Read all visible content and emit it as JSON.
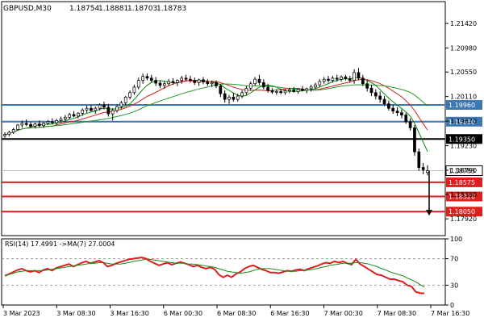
{
  "chart_data": {
    "type": "candlestick",
    "symbol_header": "GBPUSD,M30",
    "ohlc_readout": [
      "1.18754",
      "1.18881",
      "1.18703",
      "1.18783"
    ],
    "price_axis": {
      "ylim": [
        1.1762,
        1.2181
      ],
      "ticks": [
        "1.21420",
        "1.20980",
        "1.20550",
        "1.20110",
        "1.19670",
        "1.19230",
        "1.18790",
        "1.18360",
        "1.17920"
      ]
    },
    "horizontal_levels": [
      {
        "label": "1.19960",
        "value": 1.1996,
        "color": "#3b77b3"
      },
      {
        "label": "1.19660",
        "value": 1.1966,
        "color": "#3b77b3"
      },
      {
        "label": "1.19350",
        "value": 1.1935,
        "color": "#000000"
      },
      {
        "label": "1.18575",
        "value": 1.18575,
        "color": "#e01e1e"
      },
      {
        "label": "1.18320",
        "value": 1.1832,
        "color": "#e01e1e"
      },
      {
        "label": "1.18050",
        "value": 1.1805,
        "color": "#e01e1e"
      }
    ],
    "current_price": {
      "label": "1.18783",
      "value": 1.18783
    },
    "arrow_target": 1.1798,
    "candles": [
      {
        "o": 1.1941,
        "h": 1.1947,
        "l": 1.1937,
        "c": 1.1943
      },
      {
        "o": 1.1943,
        "h": 1.195,
        "l": 1.194,
        "c": 1.1947
      },
      {
        "o": 1.1947,
        "h": 1.1955,
        "l": 1.1944,
        "c": 1.1952
      },
      {
        "o": 1.1952,
        "h": 1.1962,
        "l": 1.195,
        "c": 1.196
      },
      {
        "o": 1.196,
        "h": 1.1968,
        "l": 1.1955,
        "c": 1.1963
      },
      {
        "o": 1.1963,
        "h": 1.197,
        "l": 1.1958,
        "c": 1.1961
      },
      {
        "o": 1.1961,
        "h": 1.1965,
        "l": 1.1955,
        "c": 1.1958
      },
      {
        "o": 1.1958,
        "h": 1.1964,
        "l": 1.1954,
        "c": 1.1962
      },
      {
        "o": 1.1962,
        "h": 1.1968,
        "l": 1.1956,
        "c": 1.1959
      },
      {
        "o": 1.1959,
        "h": 1.1965,
        "l": 1.1955,
        "c": 1.1963
      },
      {
        "o": 1.1963,
        "h": 1.1969,
        "l": 1.196,
        "c": 1.1966
      },
      {
        "o": 1.1966,
        "h": 1.1972,
        "l": 1.1961,
        "c": 1.1964
      },
      {
        "o": 1.1964,
        "h": 1.1971,
        "l": 1.196,
        "c": 1.1968
      },
      {
        "o": 1.1968,
        "h": 1.1975,
        "l": 1.1964,
        "c": 1.1971
      },
      {
        "o": 1.1971,
        "h": 1.1978,
        "l": 1.1966,
        "c": 1.1974
      },
      {
        "o": 1.1974,
        "h": 1.1982,
        "l": 1.197,
        "c": 1.1979
      },
      {
        "o": 1.1979,
        "h": 1.1985,
        "l": 1.1974,
        "c": 1.1976
      },
      {
        "o": 1.1976,
        "h": 1.1983,
        "l": 1.1972,
        "c": 1.1981
      },
      {
        "o": 1.1981,
        "h": 1.199,
        "l": 1.1977,
        "c": 1.1987
      },
      {
        "o": 1.1987,
        "h": 1.1995,
        "l": 1.1982,
        "c": 1.199
      },
      {
        "o": 1.199,
        "h": 1.1996,
        "l": 1.1984,
        "c": 1.1986
      },
      {
        "o": 1.1986,
        "h": 1.1993,
        "l": 1.198,
        "c": 1.199
      },
      {
        "o": 1.199,
        "h": 1.1999,
        "l": 1.1986,
        "c": 1.1996
      },
      {
        "o": 1.1996,
        "h": 1.2002,
        "l": 1.1988,
        "c": 1.1992
      },
      {
        "o": 1.1992,
        "h": 1.1998,
        "l": 1.1975,
        "c": 1.198
      },
      {
        "o": 1.198,
        "h": 1.199,
        "l": 1.1968,
        "c": 1.1986
      },
      {
        "o": 1.1986,
        "h": 1.1996,
        "l": 1.1982,
        "c": 1.1993
      },
      {
        "o": 1.1993,
        "h": 1.2003,
        "l": 1.1989,
        "c": 1.2
      },
      {
        "o": 1.2,
        "h": 1.2012,
        "l": 1.1996,
        "c": 1.201
      },
      {
        "o": 1.201,
        "h": 1.2022,
        "l": 1.2006,
        "c": 1.2018
      },
      {
        "o": 1.2018,
        "h": 1.2032,
        "l": 1.2014,
        "c": 1.2028
      },
      {
        "o": 1.2028,
        "h": 1.2045,
        "l": 1.2024,
        "c": 1.204
      },
      {
        "o": 1.204,
        "h": 1.2052,
        "l": 1.2034,
        "c": 1.2047
      },
      {
        "o": 1.2047,
        "h": 1.2052,
        "l": 1.204,
        "c": 1.2044
      },
      {
        "o": 1.2044,
        "h": 1.205,
        "l": 1.2036,
        "c": 1.204
      },
      {
        "o": 1.204,
        "h": 1.2046,
        "l": 1.203,
        "c": 1.2035
      },
      {
        "o": 1.2035,
        "h": 1.204,
        "l": 1.2026,
        "c": 1.2031
      },
      {
        "o": 1.2031,
        "h": 1.2038,
        "l": 1.2025,
        "c": 1.2034
      },
      {
        "o": 1.2034,
        "h": 1.2042,
        "l": 1.203,
        "c": 1.2038
      },
      {
        "o": 1.2038,
        "h": 1.2044,
        "l": 1.2032,
        "c": 1.2036
      },
      {
        "o": 1.2036,
        "h": 1.2042,
        "l": 1.203,
        "c": 1.204
      },
      {
        "o": 1.204,
        "h": 1.2048,
        "l": 1.2034,
        "c": 1.2044
      },
      {
        "o": 1.2044,
        "h": 1.205,
        "l": 1.2038,
        "c": 1.2042
      },
      {
        "o": 1.2042,
        "h": 1.2048,
        "l": 1.2036,
        "c": 1.204
      },
      {
        "o": 1.204,
        "h": 1.2045,
        "l": 1.2032,
        "c": 1.2036
      },
      {
        "o": 1.2036,
        "h": 1.2043,
        "l": 1.203,
        "c": 1.2041
      },
      {
        "o": 1.2041,
        "h": 1.2046,
        "l": 1.2033,
        "c": 1.2037
      },
      {
        "o": 1.2037,
        "h": 1.2042,
        "l": 1.203,
        "c": 1.2034
      },
      {
        "o": 1.2034,
        "h": 1.204,
        "l": 1.2028,
        "c": 1.2036
      },
      {
        "o": 1.2036,
        "h": 1.204,
        "l": 1.2026,
        "c": 1.203
      },
      {
        "o": 1.203,
        "h": 1.2034,
        "l": 1.201,
        "c": 1.2016
      },
      {
        "o": 1.2016,
        "h": 1.2022,
        "l": 1.2,
        "c": 1.2006
      },
      {
        "o": 1.2006,
        "h": 1.2014,
        "l": 1.1998,
        "c": 1.201
      },
      {
        "o": 1.201,
        "h": 1.2018,
        "l": 1.2002,
        "c": 1.2006
      },
      {
        "o": 1.2006,
        "h": 1.2016,
        "l": 1.2002,
        "c": 1.2012
      },
      {
        "o": 1.2012,
        "h": 1.2022,
        "l": 1.2008,
        "c": 1.2018
      },
      {
        "o": 1.2018,
        "h": 1.203,
        "l": 1.2014,
        "c": 1.2026
      },
      {
        "o": 1.2026,
        "h": 1.2038,
        "l": 1.2022,
        "c": 1.2034
      },
      {
        "o": 1.2034,
        "h": 1.2046,
        "l": 1.203,
        "c": 1.2042
      },
      {
        "o": 1.2042,
        "h": 1.205,
        "l": 1.2032,
        "c": 1.2036
      },
      {
        "o": 1.2036,
        "h": 1.2042,
        "l": 1.2024,
        "c": 1.2028
      },
      {
        "o": 1.2028,
        "h": 1.2034,
        "l": 1.2018,
        "c": 1.2022
      },
      {
        "o": 1.2022,
        "h": 1.2026,
        "l": 1.2016,
        "c": 1.2019
      },
      {
        "o": 1.2019,
        "h": 1.2024,
        "l": 1.2014,
        "c": 1.202
      },
      {
        "o": 1.202,
        "h": 1.2025,
        "l": 1.2015,
        "c": 1.2018
      },
      {
        "o": 1.2018,
        "h": 1.2024,
        "l": 1.2014,
        "c": 1.2021
      },
      {
        "o": 1.2021,
        "h": 1.2027,
        "l": 1.2017,
        "c": 1.2023
      },
      {
        "o": 1.2023,
        "h": 1.2028,
        "l": 1.2018,
        "c": 1.202
      },
      {
        "o": 1.202,
        "h": 1.2026,
        "l": 1.2016,
        "c": 1.2024
      },
      {
        "o": 1.2024,
        "h": 1.203,
        "l": 1.202,
        "c": 1.2022
      },
      {
        "o": 1.2022,
        "h": 1.2027,
        "l": 1.2017,
        "c": 1.2025
      },
      {
        "o": 1.2025,
        "h": 1.2032,
        "l": 1.202,
        "c": 1.2028
      },
      {
        "o": 1.2028,
        "h": 1.2036,
        "l": 1.2024,
        "c": 1.2032
      },
      {
        "o": 1.2032,
        "h": 1.2042,
        "l": 1.2028,
        "c": 1.2038
      },
      {
        "o": 1.2038,
        "h": 1.2046,
        "l": 1.2034,
        "c": 1.2042
      },
      {
        "o": 1.2042,
        "h": 1.2048,
        "l": 1.2036,
        "c": 1.204
      },
      {
        "o": 1.204,
        "h": 1.2048,
        "l": 1.2036,
        "c": 1.2044
      },
      {
        "o": 1.2044,
        "h": 1.205,
        "l": 1.2038,
        "c": 1.2042
      },
      {
        "o": 1.2042,
        "h": 1.2049,
        "l": 1.2038,
        "c": 1.2046
      },
      {
        "o": 1.2046,
        "h": 1.205,
        "l": 1.204,
        "c": 1.2043
      },
      {
        "o": 1.2043,
        "h": 1.2048,
        "l": 1.2036,
        "c": 1.204
      },
      {
        "o": 1.204,
        "h": 1.206,
        "l": 1.2034,
        "c": 1.2054
      },
      {
        "o": 1.2054,
        "h": 1.2062,
        "l": 1.204,
        "c": 1.2044
      },
      {
        "o": 1.2044,
        "h": 1.205,
        "l": 1.203,
        "c": 1.2034
      },
      {
        "o": 1.2034,
        "h": 1.204,
        "l": 1.202,
        "c": 1.2026
      },
      {
        "o": 1.2026,
        "h": 1.2032,
        "l": 1.2012,
        "c": 1.2018
      },
      {
        "o": 1.2018,
        "h": 1.2024,
        "l": 1.2006,
        "c": 1.2012
      },
      {
        "o": 1.2012,
        "h": 1.202,
        "l": 1.2,
        "c": 1.2006
      },
      {
        "o": 1.2006,
        "h": 1.2012,
        "l": 1.1994,
        "c": 1.1998
      },
      {
        "o": 1.1998,
        "h": 1.2004,
        "l": 1.1986,
        "c": 1.199
      },
      {
        "o": 1.199,
        "h": 1.1996,
        "l": 1.198,
        "c": 1.1985
      },
      {
        "o": 1.1985,
        "h": 1.1992,
        "l": 1.1976,
        "c": 1.1982
      },
      {
        "o": 1.1982,
        "h": 1.1988,
        "l": 1.1972,
        "c": 1.1978
      },
      {
        "o": 1.1978,
        "h": 1.1982,
        "l": 1.1962,
        "c": 1.1966
      },
      {
        "o": 1.1966,
        "h": 1.1972,
        "l": 1.195,
        "c": 1.1955
      },
      {
        "o": 1.1955,
        "h": 1.196,
        "l": 1.1905,
        "c": 1.1912
      },
      {
        "o": 1.1912,
        "h": 1.1918,
        "l": 1.1878,
        "c": 1.1884
      },
      {
        "o": 1.1884,
        "h": 1.1892,
        "l": 1.1872,
        "c": 1.188
      },
      {
        "o": 1.1875,
        "h": 1.1888,
        "l": 1.187,
        "c": 1.1878
      }
    ],
    "rsi": {
      "label": "RSI(14) 17.4991 ->MA(7) 27.0004",
      "ylim": [
        0,
        100
      ],
      "ticks": [
        "100",
        "70",
        "30",
        "0"
      ],
      "guide_levels": [
        70,
        30
      ],
      "rsi_values": [
        44,
        47,
        50,
        53,
        55,
        52,
        50,
        52,
        49,
        53,
        55,
        52,
        56,
        58,
        60,
        62,
        58,
        61,
        64,
        66,
        63,
        65,
        67,
        64,
        58,
        60,
        63,
        65,
        67,
        69,
        70,
        71,
        72,
        70,
        66,
        63,
        60,
        62,
        64,
        61,
        63,
        65,
        63,
        61,
        58,
        60,
        57,
        55,
        57,
        54,
        46,
        42,
        45,
        42,
        47,
        50,
        55,
        58,
        60,
        57,
        54,
        52,
        49,
        49,
        48,
        50,
        52,
        51,
        53,
        54,
        52,
        55,
        57,
        59,
        62,
        64,
        63,
        66,
        64,
        66,
        63,
        61,
        69,
        62,
        58,
        54,
        50,
        46,
        45,
        42,
        39,
        39,
        37,
        35,
        30,
        28,
        20,
        18,
        17.5
      ],
      "ma_values": [
        45,
        46,
        48,
        50,
        51,
        52,
        52,
        52,
        52,
        52,
        53,
        54,
        55,
        56,
        57,
        58,
        59,
        60,
        61,
        62,
        63,
        63,
        64,
        64,
        63,
        62,
        62,
        62,
        63,
        64,
        66,
        67,
        68,
        69,
        69,
        68,
        67,
        66,
        65,
        64,
        63,
        63,
        63,
        62,
        62,
        61,
        60,
        59,
        58,
        57,
        55,
        53,
        51,
        50,
        49,
        48,
        49,
        50,
        52,
        54,
        55,
        55,
        55,
        54,
        53,
        52,
        51,
        51,
        51,
        52,
        52,
        53,
        54,
        55,
        57,
        58,
        60,
        61,
        62,
        63,
        63,
        63,
        64,
        64,
        63,
        62,
        60,
        58,
        55,
        53,
        50,
        48,
        46,
        44,
        41,
        38,
        35,
        31,
        27
      ]
    },
    "time_axis": {
      "labels": [
        "3 Mar 2023",
        "3 Mar 08:30",
        "3 Mar 16:30",
        "6 Mar 00:30",
        "6 Mar 08:30",
        "6 Mar 16:30",
        "7 Mar 00:30",
        "7 Mar 08:30",
        "7 Mar 16:30"
      ]
    },
    "colors": {
      "bull_body": "#ffffff",
      "bear_body": "#000000",
      "candle_outline": "#000000",
      "ma_fast": "#0a8a0a",
      "ma_medium": "#d42020",
      "ma_slow": "#2a9a2a",
      "rsi_line": "#e01e1e",
      "rsi_ma_line": "#1a8a1a",
      "blue_level": "#3b77b3",
      "red_level": "#e01e1e"
    }
  }
}
